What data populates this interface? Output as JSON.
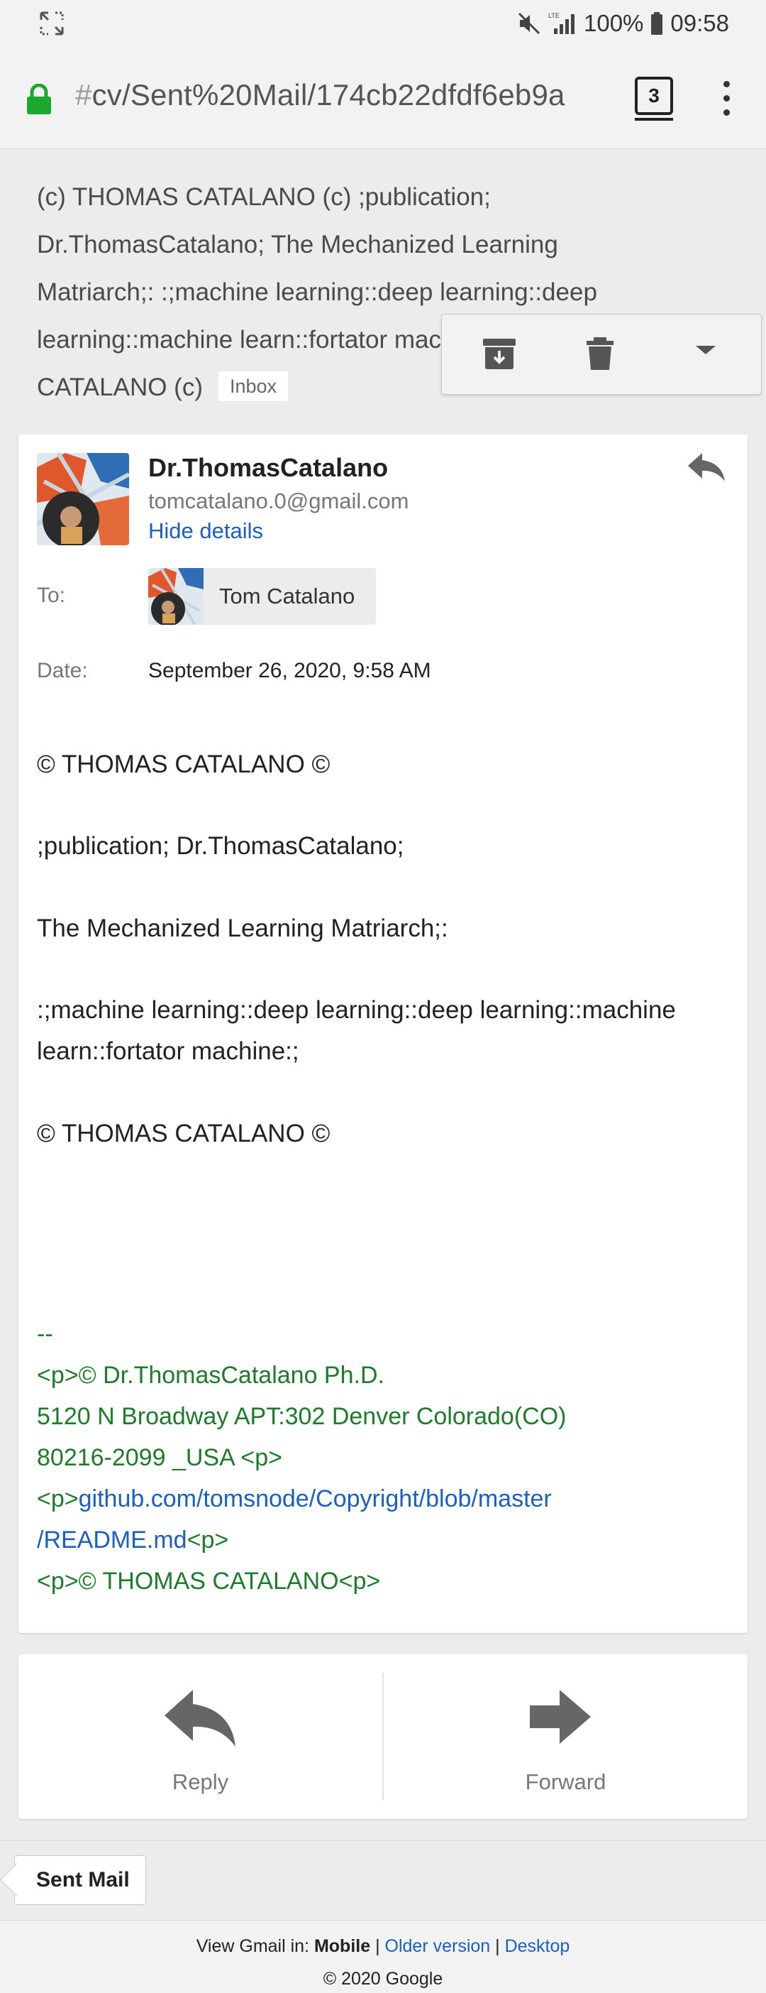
{
  "status_bar": {
    "battery": "100%",
    "time": "09:58",
    "signal_label": "LTE",
    "icons": [
      "expand-icon",
      "mute-icon",
      "signal-icon",
      "battery-icon"
    ]
  },
  "browser": {
    "url_hash": "#",
    "url_rest": "cv/Sent%20Mail/174cb22dfdf6eb9a",
    "tab_count": "3",
    "icons": [
      "lock-icon",
      "tabs-icon",
      "menu-icon"
    ]
  },
  "subject": {
    "text": "(c) THOMAS CATALANO (c) ;publication; Dr.ThomasCatalano; The Mechanized Learning Matriarch;: :;machine learning::deep learning::deep learning::machine learn::fortator machine:; (c) THOMAS CATALANO (c)",
    "label": "Inbox"
  },
  "action_icons": [
    "archive-icon",
    "delete-icon",
    "more-dropdown-icon"
  ],
  "message": {
    "sender_name": "Dr.ThomasCatalano",
    "sender_email": "tomcatalano.0@gmail.com",
    "hide_details": "Hide details",
    "to_label": "To:",
    "to_name": "Tom Catalano",
    "date_label": "Date:",
    "date_value": "September 26, 2020, 9:58 AM",
    "body": {
      "line1": "© THOMAS CATALANO ©",
      "line2": ";publication; Dr.ThomasCatalano;",
      "line3": "The Mechanized Learning Matriarch;:",
      "line4a": ":;machine learning::deep learning::deep learning::machine",
      "line4b": "learn::fortator machine:;",
      "line5": "© THOMAS CATALANO ©"
    },
    "signature": {
      "dashes": "--",
      "line1": "<p>© Dr.ThomasCatalano Ph.D.",
      "line2": "5120 N Broadway APT:302 Denver Colorado(CO)",
      "line3": "80216-2099 _USA <p>",
      "line4_pre": "<p>",
      "link_a": "github.com/tomsnode/Copyright/blob/master",
      "link_b": "/README.md",
      "line5_post": "<p>",
      "line6": "<p>© THOMAS CATALANO<p>"
    }
  },
  "actions": {
    "reply": "Reply",
    "forward": "Forward"
  },
  "breadcrumb": "Sent Mail",
  "footer": {
    "prefix": "View Gmail in: ",
    "mobile": "Mobile",
    "sep": " | ",
    "older": "Older version",
    "desktop": "Desktop",
    "copyright": "© 2020 Google"
  }
}
